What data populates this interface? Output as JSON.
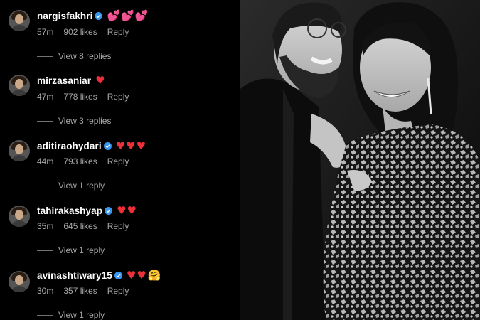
{
  "comments": [
    {
      "username": "nargisfakhri",
      "verified": true,
      "emoji": "💕💕💕",
      "emoji_kind": "pink",
      "time": "57m",
      "likes": "902 likes",
      "reply": "Reply",
      "view_replies": "View 8 replies"
    },
    {
      "username": "mirzasaniar",
      "verified": false,
      "emoji": "♥",
      "emoji_kind": "heart",
      "time": "47m",
      "likes": "778 likes",
      "reply": "Reply",
      "view_replies": "View 3 replies"
    },
    {
      "username": "aditiraohydari",
      "verified": true,
      "emoji": "♥♥♥",
      "emoji_kind": "heart",
      "time": "44m",
      "likes": "793 likes",
      "reply": "Reply",
      "view_replies": "View 1 reply"
    },
    {
      "username": "tahirakashyap",
      "verified": true,
      "emoji": "♥♥",
      "emoji_kind": "heart",
      "time": "35m",
      "likes": "645 likes",
      "reply": "Reply",
      "view_replies": "View 1 reply"
    },
    {
      "username": "avinashtiwary15",
      "verified": true,
      "emoji": "♥♥",
      "emoji_kind": "heart",
      "emoji2": "🤗",
      "time": "30m",
      "likes": "357 likes",
      "reply": "Reply",
      "view_replies": "View 1 reply"
    }
  ],
  "colors": {
    "background": "#000000",
    "text": "#ffffff",
    "meta": "#a8a8a8",
    "verified": "#3897f0",
    "heart": "#ed2f3a"
  }
}
